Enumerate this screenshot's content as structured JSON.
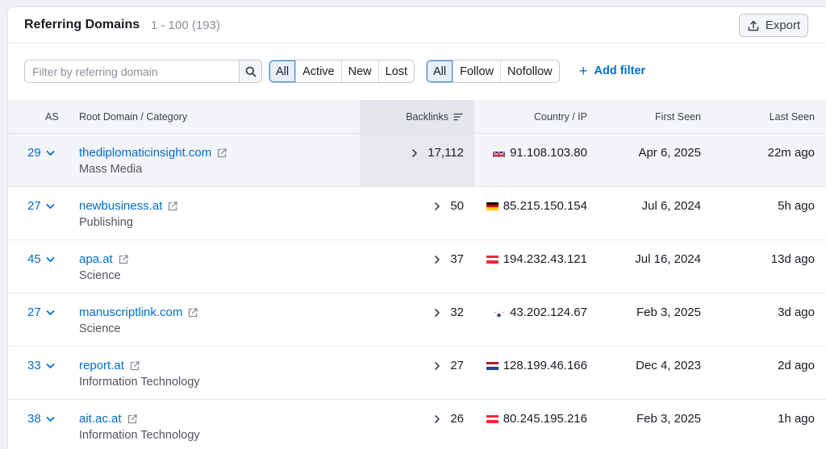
{
  "header": {
    "title": "Referring Domains",
    "range": "1 - 100 (193)",
    "export_label": "Export"
  },
  "filters": {
    "search_placeholder": "Filter by referring domain",
    "status_options": [
      "All",
      "Active",
      "New",
      "Lost"
    ],
    "status_selected": "All",
    "link_type_options": [
      "All",
      "Follow",
      "Nofollow"
    ],
    "link_type_selected": "All",
    "add_filter_label": "Add filter"
  },
  "table": {
    "columns": {
      "as": "AS",
      "domain": "Root Domain / Category",
      "backlinks": "Backlinks",
      "country": "Country / IP",
      "first_seen": "First Seen",
      "last_seen": "Last Seen"
    },
    "rows": [
      {
        "as": "29",
        "domain": "thediplomaticinsight.com",
        "category": "Mass Media",
        "backlinks": "17,112",
        "flag": "uk",
        "ip": "91.108.103.80",
        "first_seen": "Apr 6, 2025",
        "last_seen": "22m ago"
      },
      {
        "as": "27",
        "domain": "newbusiness.at",
        "category": "Publishing",
        "backlinks": "50",
        "flag": "de",
        "ip": "85.215.150.154",
        "first_seen": "Jul 6, 2024",
        "last_seen": "5h ago"
      },
      {
        "as": "45",
        "domain": "apa.at",
        "category": "Science",
        "backlinks": "37",
        "flag": "at",
        "ip": "194.232.43.121",
        "first_seen": "Jul 16, 2024",
        "last_seen": "13d ago"
      },
      {
        "as": "27",
        "domain": "manuscriptlink.com",
        "category": "Science",
        "backlinks": "32",
        "flag": "kr",
        "ip": "43.202.124.67",
        "first_seen": "Feb 3, 2025",
        "last_seen": "3d ago"
      },
      {
        "as": "33",
        "domain": "report.at",
        "category": "Information Technology",
        "backlinks": "27",
        "flag": "nl",
        "ip": "128.199.46.166",
        "first_seen": "Dec 4, 2023",
        "last_seen": "2d ago"
      },
      {
        "as": "38",
        "domain": "ait.ac.at",
        "category": "Information Technology",
        "backlinks": "26",
        "flag": "at",
        "ip": "80.245.195.216",
        "first_seen": "Feb 3, 2025",
        "last_seen": "1h ago"
      }
    ]
  },
  "colors": {
    "link": "#006dca",
    "accent_border": "#3f84d8",
    "highlight_row": "#f4f5f9"
  }
}
